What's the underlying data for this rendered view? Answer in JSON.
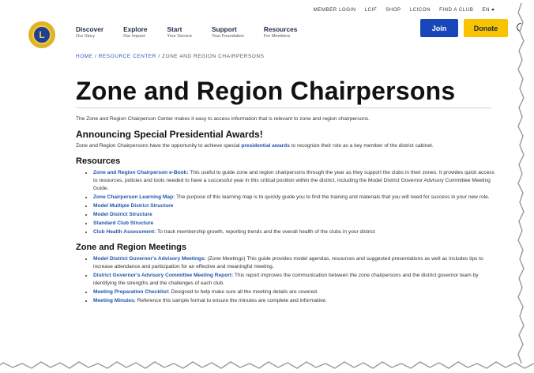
{
  "utility": {
    "member_login": "MEMBER LOGIN",
    "lcif": "LCIF",
    "shop": "SHOP",
    "lcicon": "LCICON",
    "find_club": "FIND A CLUB",
    "language": "EN"
  },
  "logo": {
    "letter": "L"
  },
  "nav": [
    {
      "title": "Discover",
      "sub": "Our Story"
    },
    {
      "title": "Explore",
      "sub": "Our Impact"
    },
    {
      "title": "Start",
      "sub": "Your Service"
    },
    {
      "title": "Support",
      "sub": "Your Foundation"
    },
    {
      "title": "Resources",
      "sub": "For Members"
    }
  ],
  "buttons": {
    "join": "Join",
    "donate": "Donate"
  },
  "breadcrumb": {
    "home": "HOME",
    "sep": " / ",
    "resource_center": "RESOURCE CENTER",
    "current": "ZONE AND REGION CHAIRPERSONS"
  },
  "page_title": "Zone and Region Chairpersons",
  "intro": "The Zone and Region Chairperson Center makes it easy to access information that is relevant to zone and region chairpersons.",
  "awards": {
    "heading": "Announcing Special Presidential Awards!",
    "text_before": "Zone and Region Chairpersons have the opportunity to achieve special ",
    "link": "presidential awards",
    "text_after": " to recognize their role as a key member of the district cabinet."
  },
  "resources": {
    "heading": "Resources",
    "items": [
      {
        "link": "Zone and Region Chairperson e-Book:",
        "text": " This useful to guide zone and region chairpersons through the year as they support the clubs in their zones. It provides quick access to resources, policies and tools needed to have a successful year in this critical position within the district, including the Model District Governor Advisory Committee Meeting Guide."
      },
      {
        "link": "Zone Chairperson Learning Map:",
        "text": " The purpose of this learning map is to quickly guide you to find the training and materials that you will need for success in your new role."
      },
      {
        "link": "Model Multiple District Structure",
        "text": ""
      },
      {
        "link": "Model District Structure",
        "text": ""
      },
      {
        "link": "Standard Club Structure",
        "text": ""
      },
      {
        "link": "Club Health Assessment:",
        "text": " To track membership growth, reporting trends and the overall health of the clubs in your district"
      }
    ]
  },
  "meetings": {
    "heading": "Zone and Region Meetings",
    "items": [
      {
        "link": "Model District Governor's Advisory Meetings:",
        "text": " (Zone Meetings) This guide provides model agendas, resources and suggested presentations as well as includes tips to increase attendance and participation for an effective and meaningful meeting."
      },
      {
        "link": "District Governor's Advisory Committee Meeting Report:",
        "text": " This report improves the communication between the zone chairpersons and the district governor team by identifying the strengths and the challenges of each club."
      },
      {
        "link": "Meeting Preparation Checklist:",
        "text": " Designed to help make sure all the meeting details are covered."
      },
      {
        "link": "Meeting Minutes:",
        "text": " Reference this sample format to ensure the minutes are complete and informative."
      }
    ]
  },
  "colors": {
    "join_bg": "#1946b8",
    "donate_bg": "#f8c400",
    "link": "#1f55b0",
    "logo_gold": "#e0b226",
    "logo_blue": "#1d3f94"
  }
}
